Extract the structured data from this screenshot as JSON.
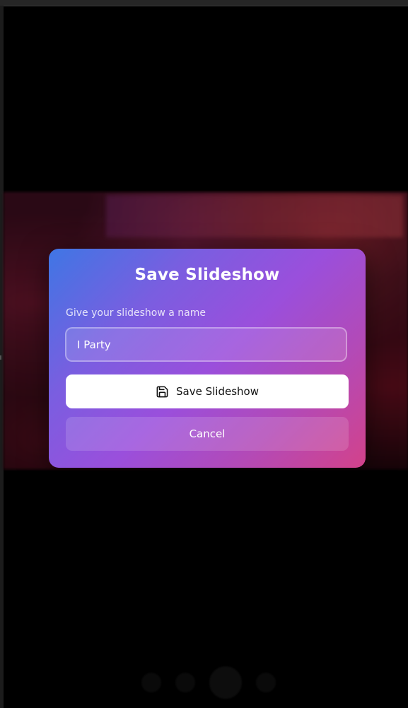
{
  "modal": {
    "title": "Save Slideshow",
    "field_label": "Give your slideshow a name",
    "name_value": "I Party",
    "save_label": "Save Slideshow",
    "save_icon": "floppy-disk-icon",
    "cancel_label": "Cancel"
  },
  "colors": {
    "modal_gradient_start": "#3f76e4",
    "modal_gradient_mid": "#9a4fdc",
    "modal_gradient_end": "#d3428a",
    "save_button_bg": "#ffffff",
    "backdrop": "#000000"
  },
  "player": {
    "controls": [
      "previous-icon",
      "rewind-icon",
      "play-icon",
      "forward-icon"
    ]
  }
}
